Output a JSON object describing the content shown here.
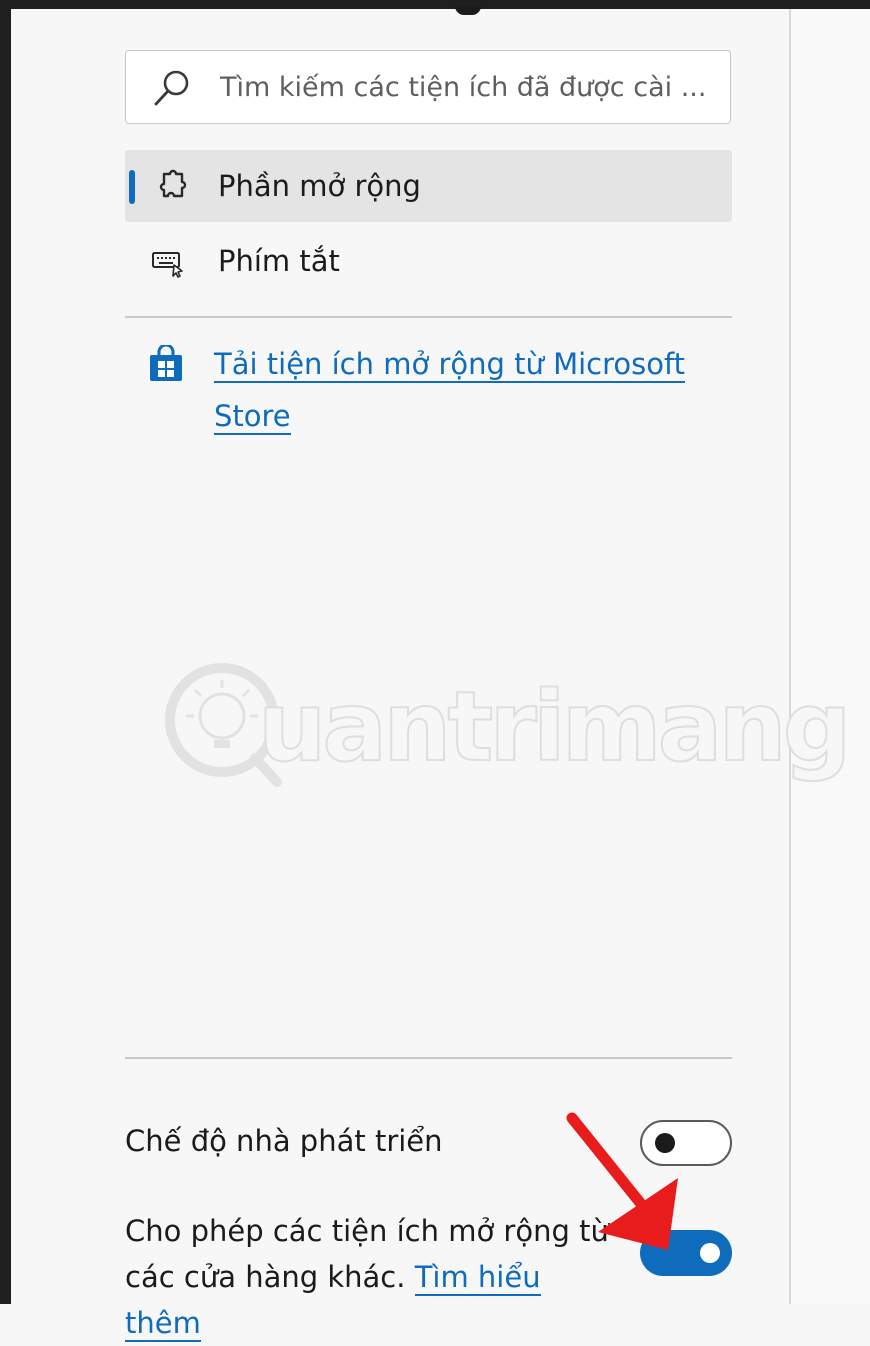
{
  "search": {
    "placeholder": "Tìm kiếm các tiện ích đã được cài ..."
  },
  "nav": {
    "items": [
      {
        "label": "Phần mở rộng",
        "icon": "puzzle-icon",
        "selected": true
      },
      {
        "label": "Phím tắt",
        "icon": "keyboard-icon",
        "selected": false
      }
    ]
  },
  "store_link": {
    "line1": "Tải tiện ích mở rộng từ Microsoft",
    "line2": "Store",
    "icon": "store-bag-icon"
  },
  "watermark": {
    "text": "uantrimang"
  },
  "settings": {
    "developer_mode": {
      "label": "Chế độ nhà phát triển",
      "enabled": false
    },
    "other_stores": {
      "label": "Cho phép các tiện ích mở rộng từ các cửa hàng khác.",
      "link": "Tìm hiểu thêm",
      "enabled": true
    }
  },
  "colors": {
    "accent": "#0f6cbd",
    "annotation_arrow": "#e81c1c",
    "background": "#f7f7f7"
  }
}
